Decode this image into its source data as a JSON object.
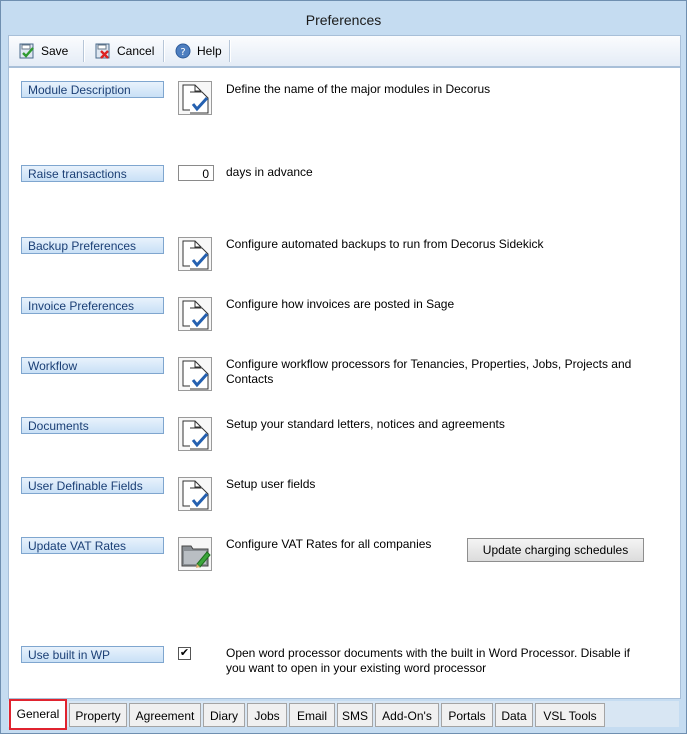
{
  "window": {
    "title": "Preferences"
  },
  "toolbar": {
    "save_label": "Save",
    "cancel_label": "Cancel",
    "help_label": "Help"
  },
  "rows": {
    "module_description": {
      "label": "Module Description",
      "desc": "Define the name of the major modules in Decorus"
    },
    "raise_transactions": {
      "label": "Raise transactions",
      "value": "0",
      "desc": "days in advance"
    },
    "backup": {
      "label": "Backup Preferences",
      "desc": "Configure automated backups to run from Decorus Sidekick"
    },
    "invoice": {
      "label": "Invoice Preferences",
      "desc": "Configure how invoices are posted in Sage"
    },
    "workflow": {
      "label": "Workflow",
      "desc": "Configure workflow processors for Tenancies, Properties, Jobs, Projects and Contacts"
    },
    "documents": {
      "label": "Documents",
      "desc": "Setup your standard letters, notices and agreements"
    },
    "udf": {
      "label": "User Definable Fields",
      "desc": "Setup user fields"
    },
    "vat": {
      "label": "Update VAT Rates",
      "desc": "Configure VAT Rates for all companies",
      "button": "Update charging schedules"
    },
    "wp": {
      "label": "Use built in WP",
      "checked": true,
      "check_glyph": "✔",
      "desc": "Open word processor documents with the built in Word Processor. Disable if you want to open in your existing word processor"
    }
  },
  "tabs": [
    {
      "label": "General",
      "active": true
    },
    {
      "label": "Property"
    },
    {
      "label": "Agreement"
    },
    {
      "label": "Diary"
    },
    {
      "label": "Jobs"
    },
    {
      "label": "Email"
    },
    {
      "label": "SMS"
    },
    {
      "label": "Add-On's"
    },
    {
      "label": "Portals"
    },
    {
      "label": "Data"
    },
    {
      "label": "VSL Tools"
    }
  ],
  "colors": {
    "active_tab_border": "#e0232f",
    "button_text": "#1b3f75"
  }
}
